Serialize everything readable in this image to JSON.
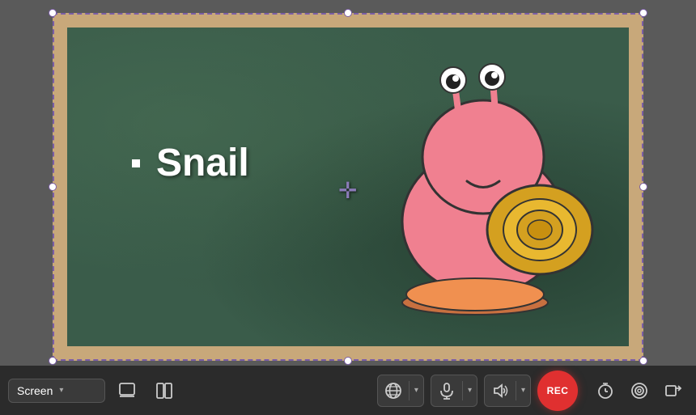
{
  "toolbar": {
    "screen_label": "Screen",
    "screen_chevron": "▾",
    "rec_label": "REC",
    "icons": {
      "layout1": "⊡",
      "layout2": "▣",
      "globe": "🌐",
      "mic": "🎙",
      "speaker": "🔊",
      "timer": "⏰",
      "settings": "⚙",
      "exit": "➜"
    }
  },
  "chalkboard": {
    "snail_text": "Snail",
    "bullet": "■"
  },
  "colors": {
    "selection_border": "#7b5ea7",
    "handle_fill": "#ffffff",
    "rec_bg": "#e03030",
    "toolbar_bg": "#2b2b2b",
    "chalkboard_bg": "#3a5c4a",
    "frame_color": "#c8a87a"
  }
}
